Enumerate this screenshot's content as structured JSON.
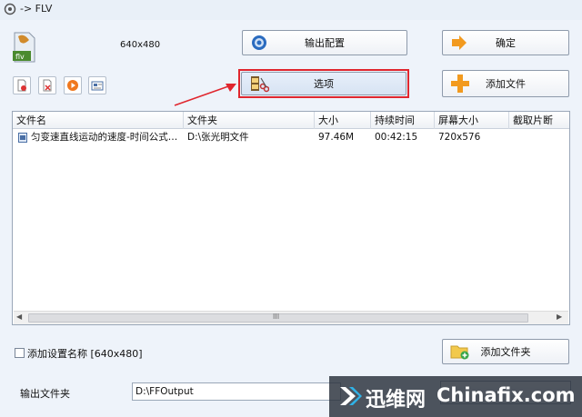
{
  "window": {
    "title": "-> FLV"
  },
  "profile": {
    "resolution": "640x480",
    "format_icon_label": "flv"
  },
  "buttons": {
    "output_config": "输出配置",
    "ok": "确定",
    "options": "选项",
    "add_file": "添加文件",
    "add_folder": "添加文件夹"
  },
  "list": {
    "columns": [
      "文件名",
      "文件夹",
      "大小",
      "持续时间",
      "屏幕大小",
      "截取片断"
    ],
    "rows": [
      {
        "name": "匀变速直线运动的速度-时间公式…",
        "folder": "D:\\张光明文件",
        "size": "97.46M",
        "duration": "00:42:15",
        "screen": "720x576",
        "clip": ""
      }
    ],
    "scroll_mark": "III"
  },
  "settings": {
    "add_name_label": "添加设置名称 [640x480]",
    "add_name_checked": false
  },
  "output": {
    "label": "输出文件夹",
    "path": "D:\\FFOutput"
  },
  "watermark": {
    "cn": "迅维网",
    "en": "Chinafix.com"
  },
  "colors": {
    "highlight": "#e0262e",
    "accent_orange": "#f29a1f"
  }
}
